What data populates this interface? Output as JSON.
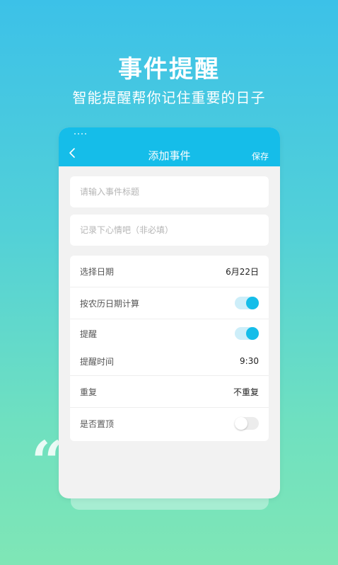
{
  "hero": {
    "title": "事件提醒",
    "subtitle": "智能提醒帮你记住重要的日子"
  },
  "decor": {
    "quote": "“"
  },
  "navbar": {
    "title": "添加事件",
    "save_label": "保存",
    "back_icon": "chevron-left-icon"
  },
  "form": {
    "title_placeholder": "请输入事件标题",
    "note_placeholder": "记录下心情吧（非必填）",
    "title_value": "",
    "note_value": ""
  },
  "settings": {
    "date_label": "选择日期",
    "date_value": "6月22日",
    "lunar_label": "按农历日期计算",
    "lunar_on": true,
    "remind_label": "提醒",
    "remind_on": true,
    "remind_time_label": "提醒时间",
    "remind_time_value": "9:30",
    "repeat_label": "重复",
    "repeat_value": "不重复",
    "pin_label": "是否置顶",
    "pin_on": false
  },
  "colors": {
    "accent": "#15bde9",
    "background_top": "#3cc1e8",
    "background_bottom": "#7fe6b6"
  }
}
